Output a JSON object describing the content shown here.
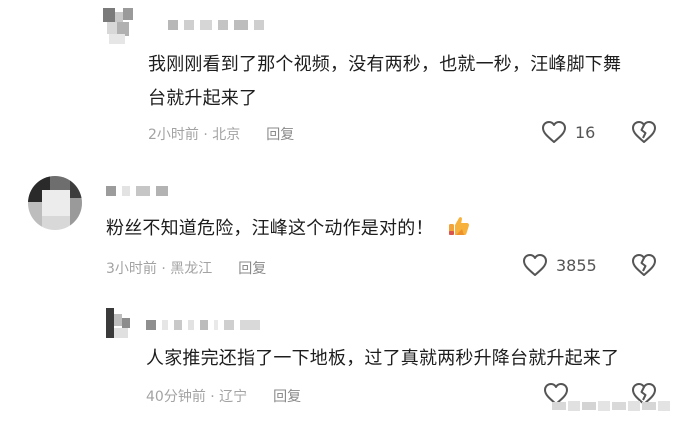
{
  "comments": [
    {
      "text_line1": "我刚刚看到了那个视频，没有两秒，也就一秒，汪峰脚下舞",
      "text_line2": "台就升起来了",
      "meta": "2小时前 · 北京",
      "reply_label": "回复",
      "likes": "16"
    },
    {
      "text": "粉丝不知道危险，汪峰这个动作是对的！",
      "emoji": "thumbs-up-emoji",
      "meta": "3小时前 · 黑龙江",
      "reply_label": "回复",
      "likes": "3855"
    },
    {
      "text": "人家推完还指了一下地板，过了真就两秒升降台就升起来了",
      "meta": "40分钟前 · 辽宁",
      "reply_label": "回复"
    }
  ],
  "icons": {
    "like": "heart-outline-icon",
    "dislike": "broken-heart-icon"
  }
}
